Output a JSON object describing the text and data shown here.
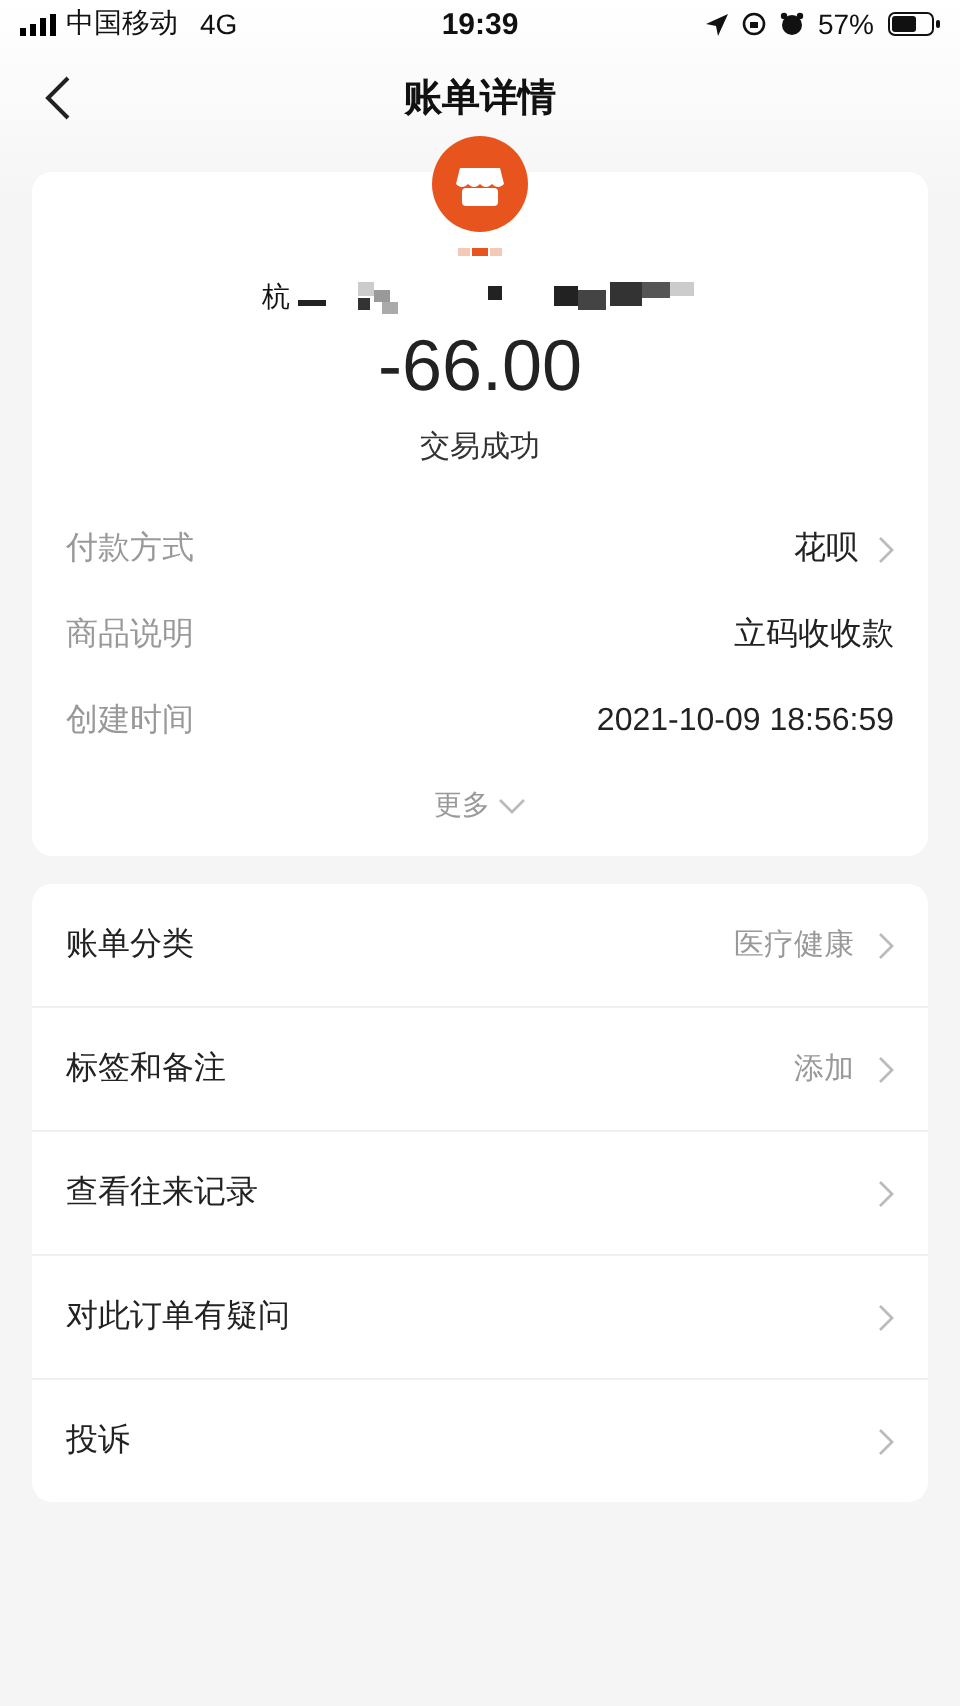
{
  "status_bar": {
    "carrier": "中国移动",
    "network": "4G",
    "time": "19:39",
    "battery": "57%"
  },
  "nav": {
    "title": "账单详情"
  },
  "summary": {
    "merchant_visible": "杭",
    "amount": "-66.00",
    "status": "交易成功",
    "details": [
      {
        "label": "付款方式",
        "value": "花呗",
        "chevron": true
      },
      {
        "label": "商品说明",
        "value": "立码收收款",
        "chevron": false
      },
      {
        "label": "创建时间",
        "value": "2021-10-09 18:56:59",
        "chevron": false
      }
    ],
    "more": "更多"
  },
  "actions": [
    {
      "label": "账单分类",
      "value": "医疗健康"
    },
    {
      "label": "标签和备注",
      "value": "添加"
    },
    {
      "label": "查看往来记录"
    },
    {
      "label": "对此订单有疑问"
    },
    {
      "label": "投诉"
    }
  ]
}
